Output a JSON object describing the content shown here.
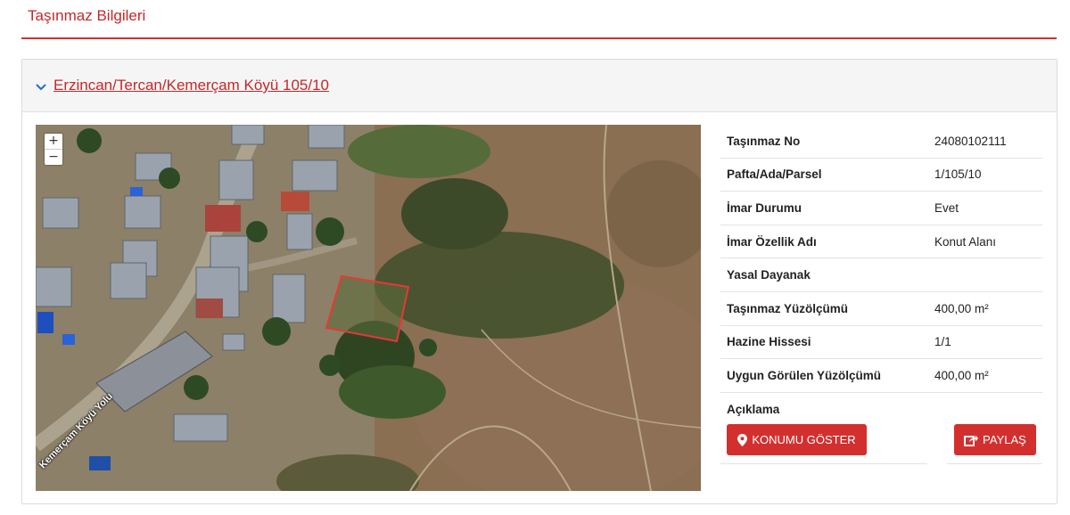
{
  "page": {
    "title": "Taşınmaz Bilgileri"
  },
  "property": {
    "header_link": "Erzincan/Tercan/Kemerçam Köyü 105/10",
    "rows": [
      {
        "label": "Taşınmaz No",
        "value": "24080102111"
      },
      {
        "label": "Pafta/Ada/Parsel",
        "value": "1/105/10"
      },
      {
        "label": "İmar Durumu",
        "value": "Evet"
      },
      {
        "label": "İmar Özellik Adı",
        "value": "Konut Alanı"
      },
      {
        "label": "Yasal Dayanak",
        "value": ""
      },
      {
        "label": "Taşınmaz Yüzölçümü",
        "value": "400,00 m²"
      },
      {
        "label": "Hazine Hissesi",
        "value": "1/1"
      },
      {
        "label": "Uygun Görülen Yüzölçümü",
        "value": "400,00 m²"
      },
      {
        "label": "Açıklama",
        "value": ""
      }
    ]
  },
  "map": {
    "zoom_in": "+",
    "zoom_out": "−",
    "road_label": "Kemerçam Köyü Yolu",
    "parcel_color": "#e53935"
  },
  "buttons": {
    "show_location": "KONUMU GÖSTER",
    "share": "PAYLAŞ"
  },
  "colors": {
    "accent": "#d32f2f"
  }
}
